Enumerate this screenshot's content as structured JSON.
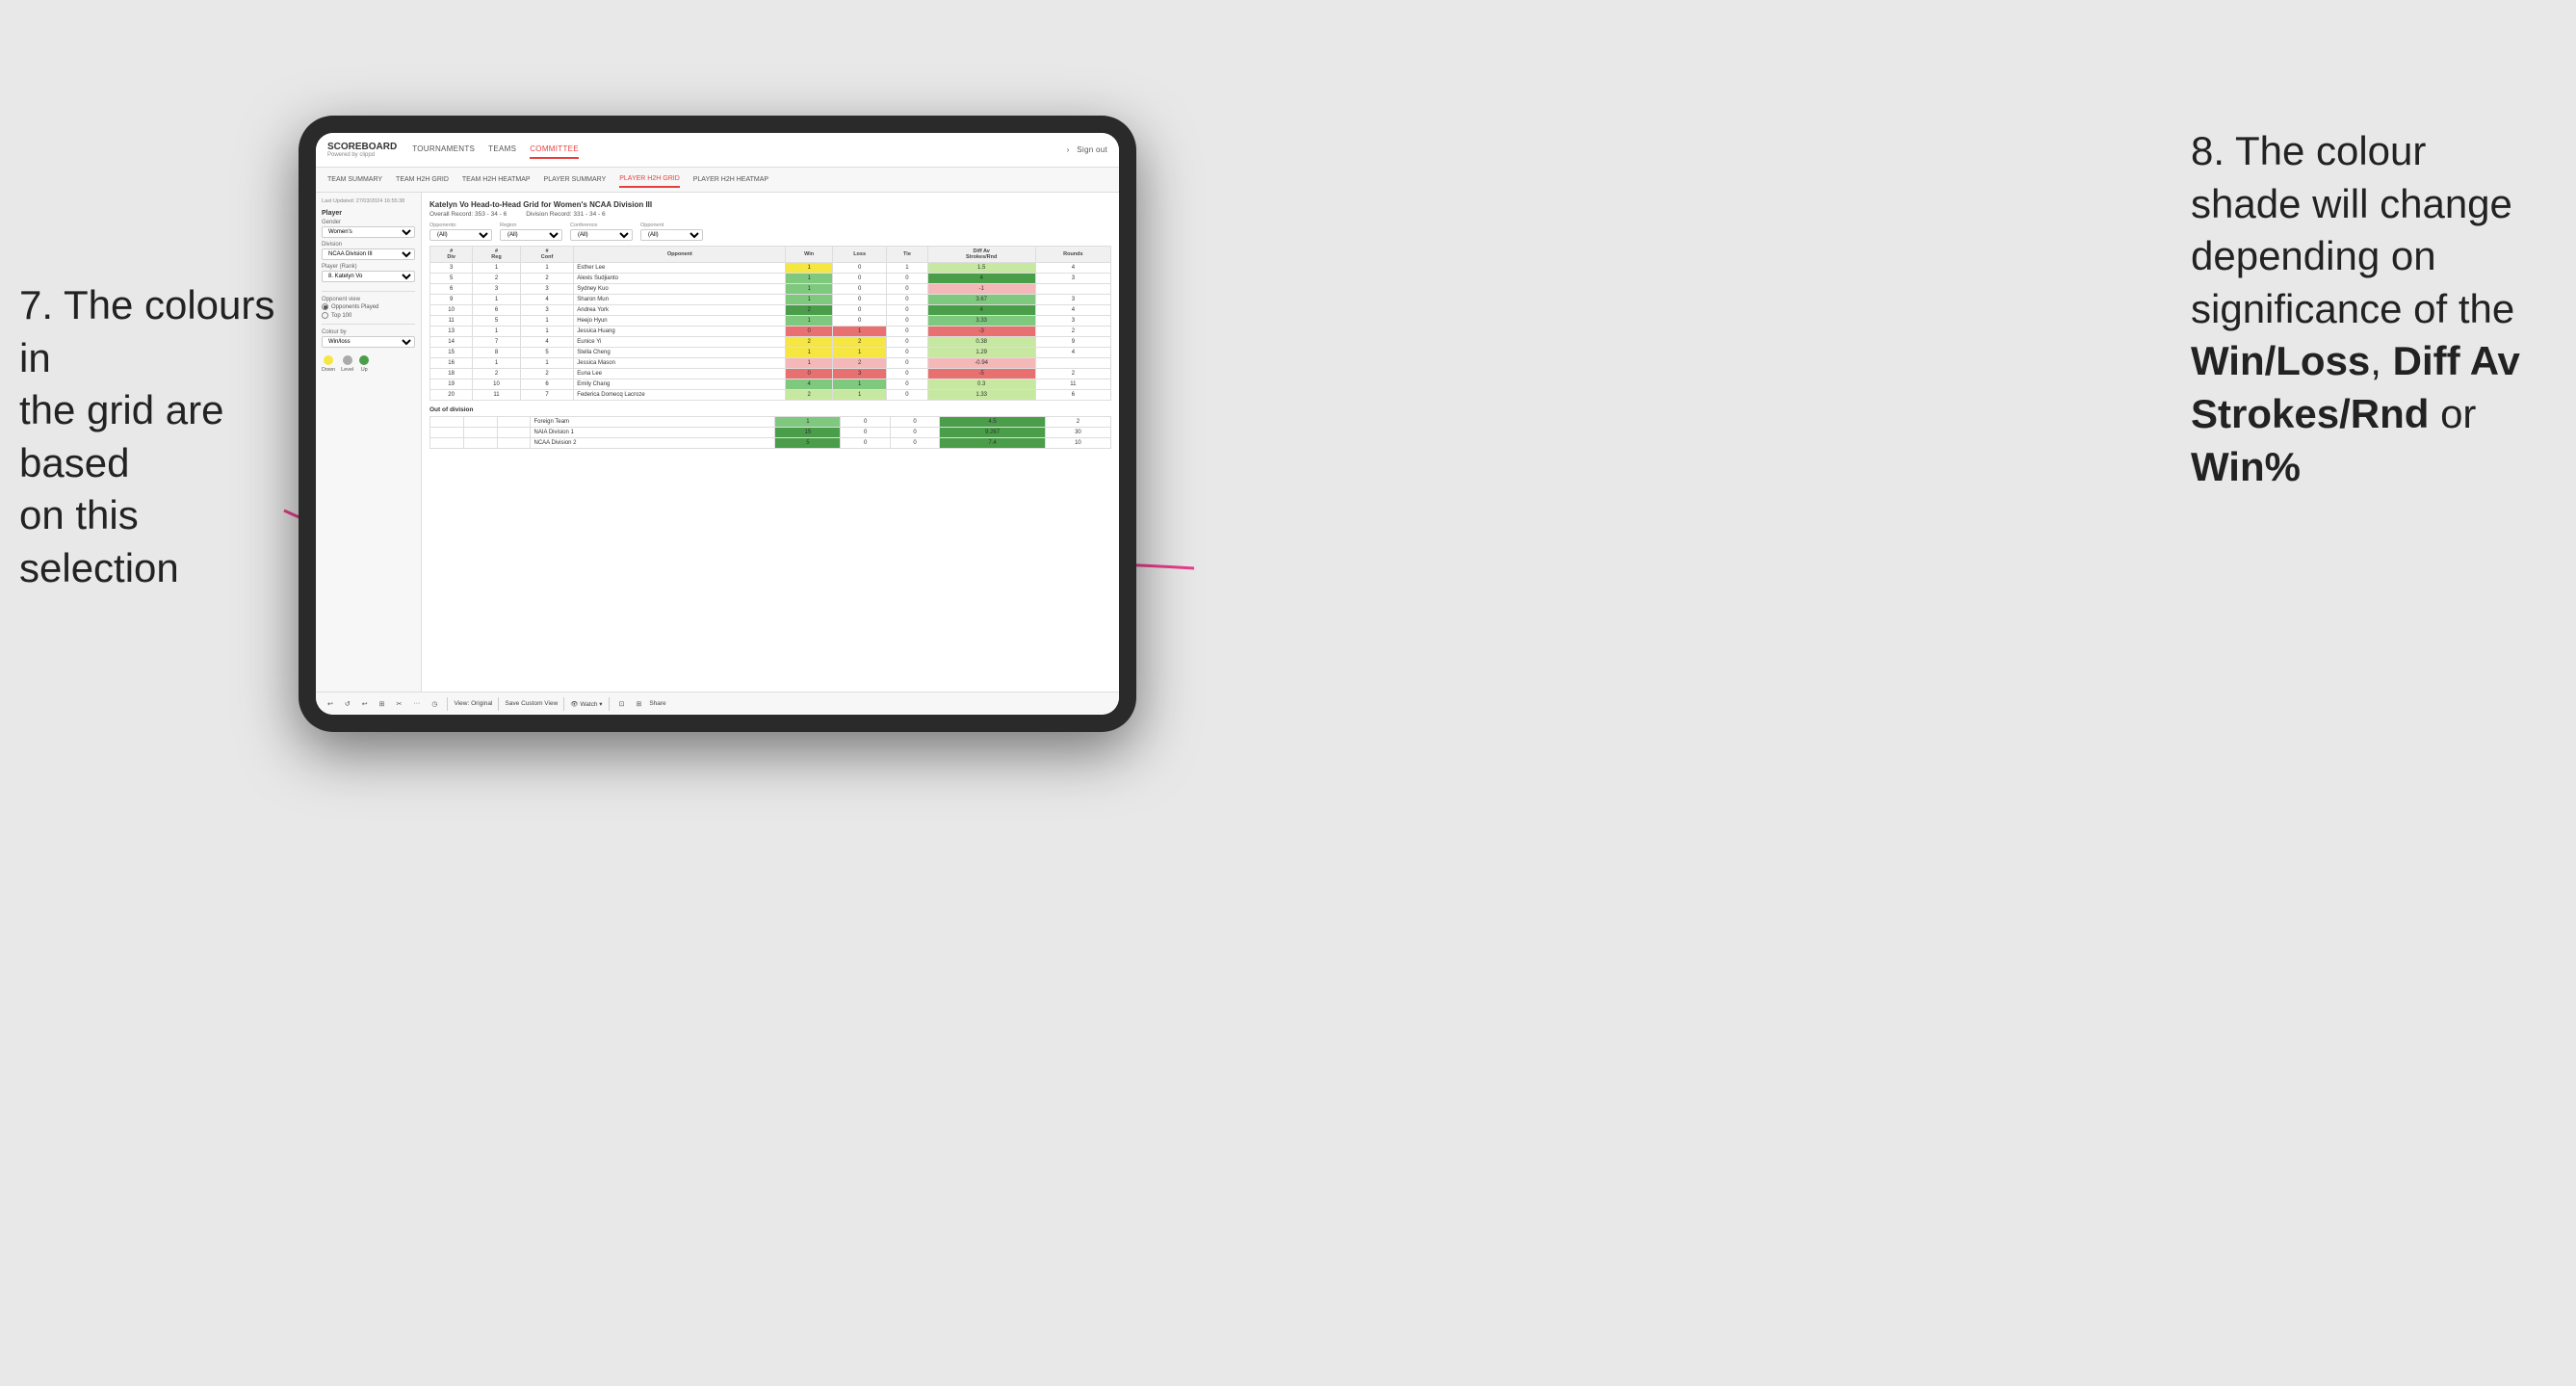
{
  "annotations": {
    "left": {
      "line1": "7. The colours in",
      "line2": "the grid are based",
      "line3": "on this selection"
    },
    "right": {
      "line1": "8. The colour",
      "line2": "shade will change",
      "line3": "depending on",
      "line4": "significance of the",
      "bold1": "Win/Loss",
      "comma1": ", ",
      "bold2": "Diff Av",
      "line5": "Strokes/Rnd",
      "line6": "or",
      "bold3": "Win%"
    }
  },
  "nav": {
    "logo": "SCOREBOARD",
    "logo_sub": "Powered by clippd",
    "items": [
      "TOURNAMENTS",
      "TEAMS",
      "COMMITTEE"
    ],
    "active_item": "COMMITTEE",
    "right_items": [
      "Sign out"
    ]
  },
  "sub_nav": {
    "items": [
      "TEAM SUMMARY",
      "TEAM H2H GRID",
      "TEAM H2H HEATMAP",
      "PLAYER SUMMARY",
      "PLAYER H2H GRID",
      "PLAYER H2H HEATMAP"
    ],
    "active_item": "PLAYER H2H GRID"
  },
  "sidebar": {
    "timestamp": "Last Updated: 27/03/2024 16:55:38",
    "section_player": "Player",
    "gender_label": "Gender",
    "gender_value": "Women's",
    "division_label": "Division",
    "division_value": "NCAA Division III",
    "player_rank_label": "Player (Rank)",
    "player_rank_value": "8. Katelyn Vo",
    "opponent_view_label": "Opponent view",
    "opponent_view_options": [
      "Opponents Played",
      "Top 100"
    ],
    "opponent_view_selected": "Opponents Played",
    "colour_by_label": "Colour by",
    "colour_by_value": "Win/loss",
    "legend": {
      "down_label": "Down",
      "level_label": "Level",
      "up_label": "Up",
      "down_color": "#f5e642",
      "level_color": "#aaaaaa",
      "up_color": "#4a9e4a"
    }
  },
  "grid": {
    "title": "Katelyn Vo Head-to-Head Grid for Women's NCAA Division III",
    "overall_record_label": "Overall Record:",
    "overall_record_value": "353 - 34 - 6",
    "division_record_label": "Division Record:",
    "division_record_value": "331 - 34 - 6",
    "filters": {
      "opponents_label": "Opponents:",
      "opponents_value": "(All)",
      "region_label": "Region",
      "region_value": "(All)",
      "conference_label": "Conference",
      "conference_value": "(All)",
      "opponent_label": "Opponent",
      "opponent_value": "(All)"
    },
    "table_headers": {
      "div": "#\nDiv",
      "reg": "#\nReg",
      "conf": "#\nConf",
      "opponent": "Opponent",
      "win": "Win",
      "loss": "Loss",
      "tie": "Tie",
      "diff_av": "Diff Av\nStrokes/Rnd",
      "rounds": "Rounds"
    },
    "rows": [
      {
        "div": "3",
        "reg": "1",
        "conf": "1",
        "opponent": "Esther Lee",
        "win": 1,
        "loss": 0,
        "tie": 1,
        "diff_av": 1.5,
        "rounds": 4,
        "win_color": "yellow",
        "diff_color": "green-light"
      },
      {
        "div": "5",
        "reg": "2",
        "conf": "2",
        "opponent": "Alexis Sudjianto",
        "win": 1,
        "loss": 0,
        "tie": 0,
        "diff_av": 4.0,
        "rounds": 3,
        "win_color": "green-med",
        "diff_color": "green-dark"
      },
      {
        "div": "6",
        "reg": "3",
        "conf": "3",
        "opponent": "Sydney Kuo",
        "win": 1,
        "loss": 0,
        "tie": 0,
        "diff_av": -1.0,
        "rounds": "",
        "win_color": "green-med",
        "diff_color": "red-light"
      },
      {
        "div": "9",
        "reg": "1",
        "conf": "4",
        "opponent": "Sharon Mun",
        "win": 1,
        "loss": 0,
        "tie": 0,
        "diff_av": 3.67,
        "rounds": 3,
        "win_color": "green-med",
        "diff_color": "green-med"
      },
      {
        "div": "10",
        "reg": "6",
        "conf": "3",
        "opponent": "Andrea York",
        "win": 2,
        "loss": 0,
        "tie": 0,
        "diff_av": 4.0,
        "rounds": 4,
        "win_color": "green-dark",
        "diff_color": "green-dark"
      },
      {
        "div": "11",
        "reg": "5",
        "conf": "1",
        "opponent": "Heejo Hyun",
        "win": 1,
        "loss": 0,
        "tie": 0,
        "diff_av": 3.33,
        "rounds": 3,
        "win_color": "green-med",
        "diff_color": "green-med"
      },
      {
        "div": "13",
        "reg": "1",
        "conf": "1",
        "opponent": "Jessica Huang",
        "win": 0,
        "loss": 1,
        "tie": 0,
        "diff_av": -3.0,
        "rounds": 2,
        "win_color": "red-med",
        "diff_color": "red-med"
      },
      {
        "div": "14",
        "reg": "7",
        "conf": "4",
        "opponent": "Eunice Yi",
        "win": 2,
        "loss": 2,
        "tie": 0,
        "diff_av": 0.38,
        "rounds": 9,
        "win_color": "yellow",
        "diff_color": "green-light"
      },
      {
        "div": "15",
        "reg": "8",
        "conf": "5",
        "opponent": "Stella Cheng",
        "win": 1,
        "loss": 1,
        "tie": 0,
        "diff_av": 1.29,
        "rounds": 4,
        "win_color": "yellow",
        "diff_color": "green-light"
      },
      {
        "div": "16",
        "reg": "1",
        "conf": "1",
        "opponent": "Jessica Mason",
        "win": 1,
        "loss": 2,
        "tie": 0,
        "diff_av": -0.94,
        "rounds": "",
        "win_color": "red-light",
        "diff_color": "red-light"
      },
      {
        "div": "18",
        "reg": "2",
        "conf": "2",
        "opponent": "Euna Lee",
        "win": 0,
        "loss": 3,
        "tie": 0,
        "diff_av": -5.0,
        "rounds": 2,
        "win_color": "red-med",
        "diff_color": "red-med"
      },
      {
        "div": "19",
        "reg": "10",
        "conf": "6",
        "opponent": "Emily Chang",
        "win": 4,
        "loss": 1,
        "tie": 0,
        "diff_av": 0.3,
        "rounds": 11,
        "win_color": "green-med",
        "diff_color": "green-light"
      },
      {
        "div": "20",
        "reg": "11",
        "conf": "7",
        "opponent": "Federica Domecq Lacroze",
        "win": 2,
        "loss": 1,
        "tie": 0,
        "diff_av": 1.33,
        "rounds": 6,
        "win_color": "green-light",
        "diff_color": "green-light"
      }
    ],
    "out_of_division": {
      "label": "Out of division",
      "rows": [
        {
          "opponent": "Foreign Team",
          "win": 1,
          "loss": 0,
          "tie": 0,
          "diff_av": 4.5,
          "rounds": 2,
          "win_color": "green-med",
          "diff_color": "green-dark"
        },
        {
          "opponent": "NAIA Division 1",
          "win": 15,
          "loss": 0,
          "tie": 0,
          "diff_av": 9.267,
          "rounds": 30,
          "win_color": "green-dark",
          "diff_color": "green-dark"
        },
        {
          "opponent": "NCAA Division 2",
          "win": 5,
          "loss": 0,
          "tie": 0,
          "diff_av": 7.4,
          "rounds": 10,
          "win_color": "green-dark",
          "diff_color": "green-dark"
        }
      ]
    }
  },
  "toolbar": {
    "buttons": [
      "↩",
      "↺",
      "↩",
      "⊞",
      "✂",
      "·",
      "◷",
      "|",
      "View: Original",
      "|",
      "Save Custom View",
      "|",
      "👁 Watch ▾",
      "|",
      "⊡",
      "⊞",
      "Share"
    ]
  }
}
